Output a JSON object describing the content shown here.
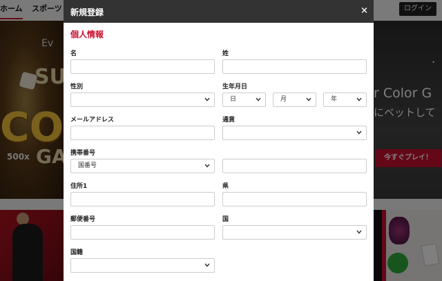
{
  "background": {
    "nav": {
      "home": "ホーム",
      "sports": "スポーツ",
      "login": "ログイン"
    },
    "banner_left": {
      "logo": "Ev",
      "line1": "SU",
      "line2": "CO",
      "multiplier": "500x",
      "line3": "GA"
    },
    "banner_right": {
      "headline": "r Color G",
      "subline": "にベットして",
      "play_button": "今すぐプレイ！"
    }
  },
  "modal": {
    "title": "新規登録",
    "close": "×",
    "section": "個人情報",
    "labels": {
      "first_name": "名",
      "last_name": "姓",
      "gender": "性別",
      "birthdate": "生年月日",
      "email": "メールアドレス",
      "currency": "通貨",
      "mobile": "携帯番号",
      "address": "住所1",
      "prefecture": "県",
      "postal": "郵便番号",
      "country": "国",
      "nationality": "国籍"
    },
    "selects": {
      "day": "日",
      "month": "月",
      "year": "年",
      "country_code": "国番号",
      "gender": "",
      "currency": "",
      "country": "",
      "nationality": ""
    }
  }
}
